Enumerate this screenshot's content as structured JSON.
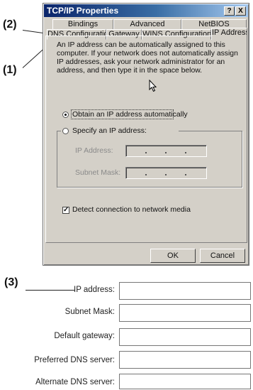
{
  "callouts": {
    "c1": "(1)",
    "c2": "(2)",
    "c3": "(3)"
  },
  "dialog": {
    "title": "TCP/IP Properties",
    "title_buttons": {
      "help": "?",
      "close": "X"
    },
    "tabs_row1": [
      "Bindings",
      "Advanced",
      "NetBIOS"
    ],
    "tabs_row2": [
      "DNS Configuration",
      "Gateway",
      "WINS Configuration",
      "IP Address"
    ],
    "active_tab": "IP Address",
    "description": "An IP address can be automatically assigned to this computer. If your network does not automatically assign IP addresses, ask your network administrator for an address, and then type it in the space below.",
    "radio_obtain": "Obtain an IP address automatically",
    "radio_specify": "Specify an IP address:",
    "ip_label": "IP Address:",
    "mask_label": "Subnet Mask:",
    "detect_label": "Detect connection to network media",
    "ok": "OK",
    "cancel": "Cancel"
  },
  "form": {
    "ip_address": "IP address:",
    "subnet_mask": "Subnet Mask:",
    "default_gateway": "Default gateway:",
    "preferred_dns": "Preferred DNS server:",
    "alternate_dns": "Alternate DNS server:"
  }
}
